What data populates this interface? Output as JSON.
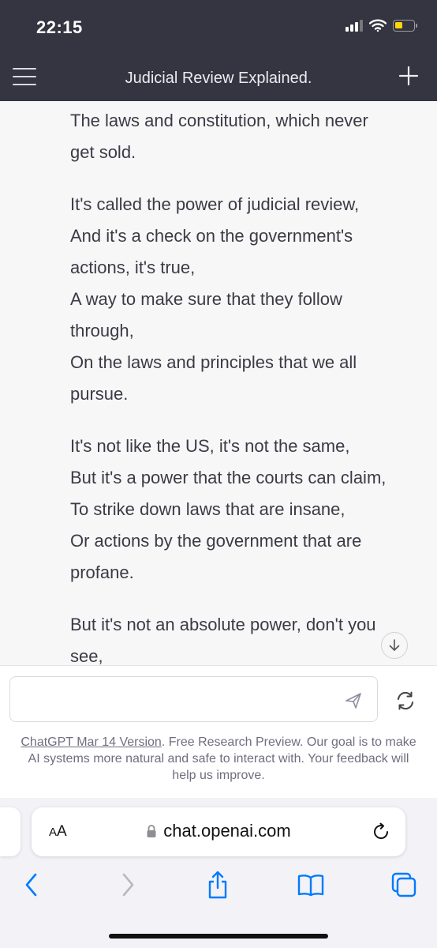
{
  "status_bar": {
    "time": "22:15",
    "battery_level": 0.45
  },
  "nav": {
    "title": "Judicial Review Explained."
  },
  "message": {
    "stanzas": [
      [
        "The laws and constitution, which never",
        "get sold."
      ],
      [
        "It's called the power of judicial review,",
        "And it's a check on the government's",
        "actions, it's true,",
        "A way to make sure that they follow",
        "through,",
        "On the laws and principles that we all",
        "pursue."
      ],
      [
        "It's not like the US, it's not the same,",
        "But it's a power that the courts can claim,",
        "To strike down laws that are insane,",
        "Or actions by the government that are",
        "profane."
      ],
      [
        "But it's not an absolute power, don't you",
        "see,"
      ]
    ]
  },
  "composer": {
    "value": "",
    "placeholder": ""
  },
  "footer": {
    "version_link": "ChatGPT Mar 14 Version",
    "note": ". Free Research Preview. Our goal is to make AI systems more natural and safe to interact with. Your feedback will help us improve."
  },
  "safari": {
    "aa_label_small": "A",
    "aa_label_large": "A",
    "url": "chat.openai.com"
  },
  "icons": {
    "menu": "hamburger-icon",
    "new_chat": "plus-icon",
    "scroll_down": "arrow-down-icon",
    "send": "send-icon",
    "regenerate": "refresh-icon",
    "lock": "lock-icon",
    "reload": "reload-icon",
    "back": "chevron-left-icon",
    "forward": "chevron-right-icon",
    "share": "share-icon",
    "bookmarks": "book-icon",
    "tabs": "tabs-icon"
  },
  "colors": {
    "header_bg": "#343541",
    "page_bg": "#f7f7f8",
    "safari_accent": "#007aff",
    "battery": "#ffd60a"
  }
}
